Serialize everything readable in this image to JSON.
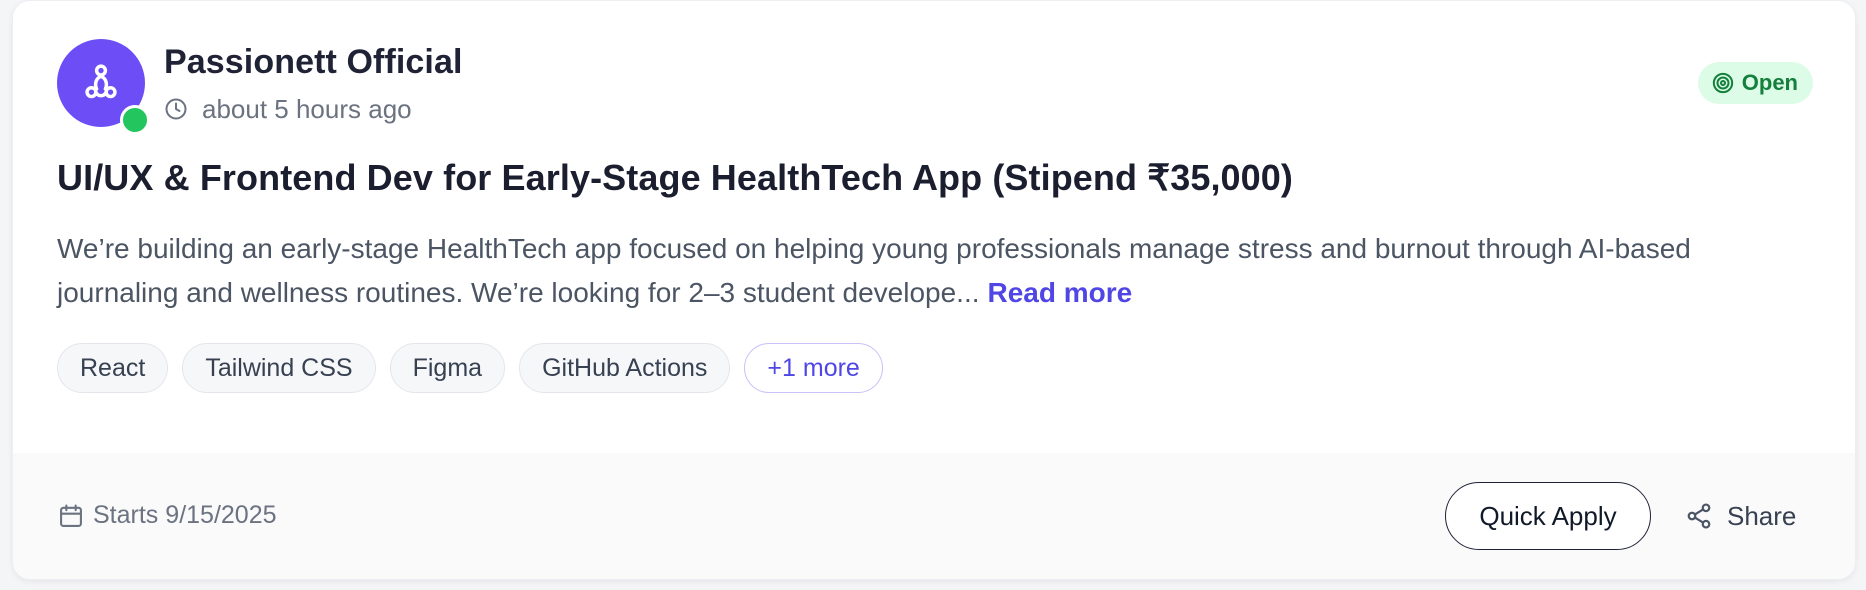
{
  "company": {
    "name": "Passionett Official",
    "posted": "about 5 hours ago",
    "avatar_icon": "community-icon",
    "online": true,
    "avatar_color": "#6d4df6",
    "online_color": "#22c55e"
  },
  "status": {
    "label": "Open",
    "icon": "target-icon",
    "color": "#15803d",
    "background": "#dcfce7"
  },
  "job": {
    "title": "UI/UX & Frontend Dev for Early-Stage HealthTech App (Stipend ₹35,000)",
    "description": "We’re building an early-stage HealthTech app focused on helping young professionals manage stress and burnout through AI-based journaling and wellness routines. We’re looking for 2–3 student develope...",
    "read_more": "Read more"
  },
  "tags": {
    "items": [
      "React",
      "Tailwind CSS",
      "Figma",
      "GitHub Actions"
    ],
    "more": "+1 more"
  },
  "footer": {
    "start_prefix": "Starts",
    "start_date": "9/15/2025",
    "quick_apply": "Quick Apply",
    "share": "Share"
  },
  "accent_color": "#4f46e5"
}
